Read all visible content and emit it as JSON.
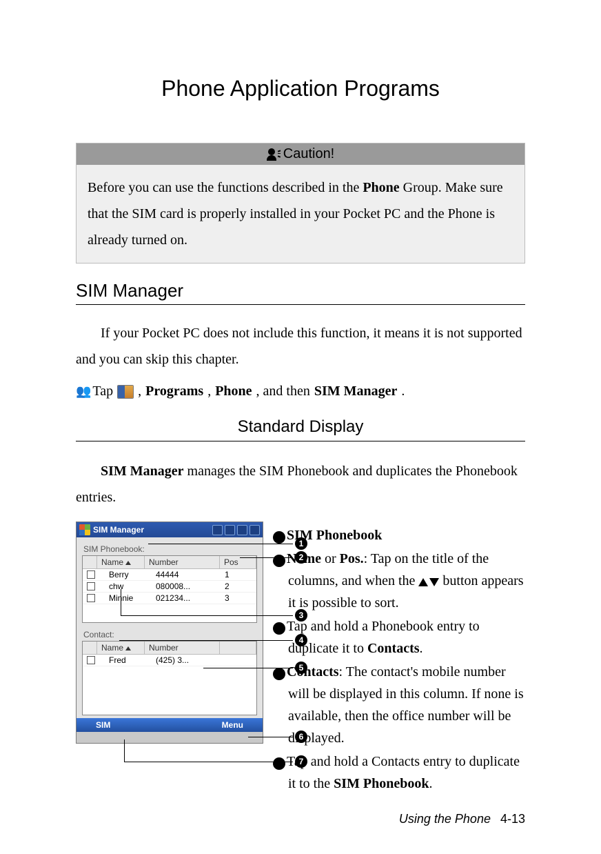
{
  "title": "Phone Application Programs",
  "caution": {
    "label": "Caution!",
    "body_prefix": "Before you can use the functions described in the ",
    "body_bold1": "Phone",
    "body_suffix": " Group. Make sure that the SIM card is properly installed in your Pocket PC and the Phone is already turned on."
  },
  "section1": {
    "heading": "SIM Manager",
    "body": "If your Pocket PC does not include this function, it means it is not supported and you can skip this chapter."
  },
  "tap": {
    "tap_label": "Tap",
    "programs": "Programs",
    "comma1": ", ",
    "phone": "Phone",
    "comma2": ", and then ",
    "sim_manager": "SIM Manager",
    "period": "."
  },
  "subheading": "Standard Display",
  "sim_intro_prefix": "SIM Manager",
  "sim_intro_suffix": " manages the SIM Phonebook and duplicates the Phonebook entries.",
  "screenshot": {
    "titlebar": "SIM Manager",
    "sim_phonebook_label": "SIM Phonebook:",
    "headers": {
      "name": "Name",
      "number": "Number",
      "pos": "Pos"
    },
    "rows": [
      {
        "name": "Berry",
        "number": "44444",
        "pos": "1"
      },
      {
        "name": "chw",
        "number": "080008...",
        "pos": "2"
      },
      {
        "name": "Minnie",
        "number": "021234...",
        "pos": "3"
      }
    ],
    "contact_label": "Contact:",
    "contact_headers": {
      "name": "Name",
      "number": "Number"
    },
    "contact_rows": [
      {
        "name": "Fred",
        "number": "(425) 3..."
      }
    ],
    "soft_left": "SIM",
    "soft_right": "Menu"
  },
  "callouts": {
    "n1": "1",
    "n2": "2",
    "n3": "3",
    "n4": "4",
    "n5": "5",
    "n6": "6",
    "n7": "7"
  },
  "notes": {
    "n1_bold": "SIM Phonebook",
    "n2_a": "Name",
    "n2_or": " or ",
    "n2_b": "Pos.",
    "n2_text1": ": Tap on the title of the columns, and when the ",
    "n2_text2": " button appears it is possible to sort.",
    "n3_text_a": "Tap and hold a Phonebook entry to duplicate it to ",
    "n3_bold": "Contacts",
    "n3_text_b": ".",
    "n4_bold": "Contacts",
    "n4_text": ": The contact's mobile number will be displayed in this column. If none is available, then the office number will be displayed.",
    "n5_text_a": "Tap and hold a Contacts entry to duplicate it to the ",
    "n5_bold": "SIM Phonebook",
    "n5_text_b": "."
  },
  "footer": {
    "label": "Using the Phone",
    "page": "4-13"
  }
}
